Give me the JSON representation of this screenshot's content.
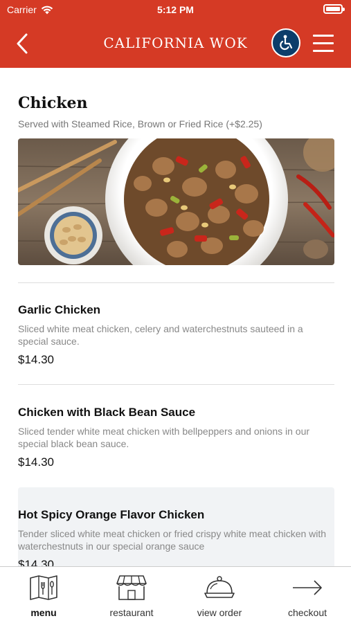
{
  "status_bar": {
    "carrier": "Carrier",
    "time": "5:12 PM"
  },
  "header": {
    "title": "CALIFORNIA WOK",
    "accent_color": "#d53a25"
  },
  "section": {
    "title": "Chicken",
    "subtitle": "Served with Steamed Rice, Brown or Fried Rice (+$2.25)"
  },
  "menu_items": [
    {
      "name": "Garlic Chicken",
      "description": "Sliced white meat chicken, celery and waterchestnuts sauteed in a special sauce.",
      "price": "$14.30"
    },
    {
      "name": "Chicken with Black Bean Sauce",
      "description": "Sliced tender white meat chicken with bellpeppers and onions in our special black bean sauce.",
      "price": "$14.30"
    },
    {
      "name": "Hot Spicy Orange Flavor Chicken",
      "description": "Tender sliced white meat chicken or fried crispy white meat chicken with waterchestnuts in our special orange sauce",
      "price": "$14.30"
    }
  ],
  "tabs": [
    {
      "label": "menu",
      "icon": "menu-book-icon",
      "active": true
    },
    {
      "label": "restaurant",
      "icon": "storefront-icon",
      "active": false
    },
    {
      "label": "view order",
      "icon": "cloche-icon",
      "active": false
    },
    {
      "label": "checkout",
      "icon": "arrow-right-icon",
      "active": false
    }
  ]
}
